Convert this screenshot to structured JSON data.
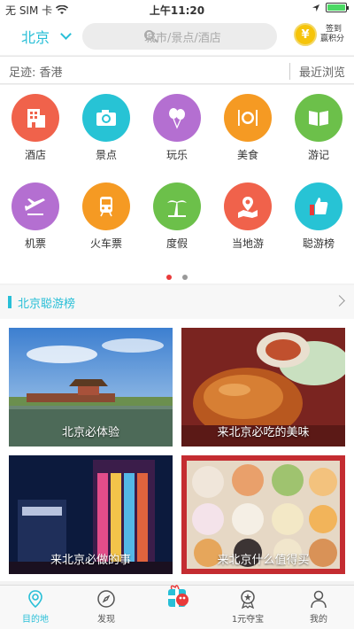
{
  "status": {
    "carrier": "无 SIM 卡",
    "time": "上午11:20"
  },
  "header": {
    "city": "北京",
    "search_placeholder": "城市/景点/酒店",
    "signin_line1": "签到",
    "signin_line2": "赢积分",
    "coin_symbol": "¥"
  },
  "history": {
    "footprint": "足迹: 香港",
    "recent": "最近浏览"
  },
  "categories": [
    {
      "label": "酒店",
      "icon": "hotel-icon",
      "color": "#f0624b"
    },
    {
      "label": "景点",
      "icon": "camera-icon",
      "color": "#27c3d5"
    },
    {
      "label": "玩乐",
      "icon": "balloons-icon",
      "color": "#b46fd1"
    },
    {
      "label": "美食",
      "icon": "dining-icon",
      "color": "#f59a23"
    },
    {
      "label": "游记",
      "icon": "book-icon",
      "color": "#6cc04a"
    },
    {
      "label": "机票",
      "icon": "airplane-icon",
      "color": "#b46fd1"
    },
    {
      "label": "火车票",
      "icon": "train-icon",
      "color": "#f59a23"
    },
    {
      "label": "度假",
      "icon": "palm-tree-icon",
      "color": "#6cc04a"
    },
    {
      "label": "当地游",
      "icon": "map-pin-icon",
      "color": "#f0624b"
    },
    {
      "label": "聪游榜",
      "icon": "thumbs-up-icon",
      "color": "#27c3d5"
    }
  ],
  "pager": {
    "pages": 2,
    "active": 0
  },
  "section": {
    "title": "北京聪游榜"
  },
  "cards": [
    {
      "caption": "北京必体验"
    },
    {
      "caption": "来北京必吃的美味"
    },
    {
      "caption": "来北京必做的事"
    },
    {
      "caption": "来北京什么值得买"
    }
  ],
  "tabs": [
    {
      "label": "目的地",
      "icon": "location-pin-icon"
    },
    {
      "label": "发现",
      "icon": "compass-icon"
    },
    {
      "label": "",
      "icon": "gift-mascot-icon"
    },
    {
      "label": "1元夺宝",
      "icon": "medal-icon"
    },
    {
      "label": "我的",
      "icon": "user-icon"
    }
  ],
  "colors": {
    "accent": "#28bfd7",
    "pager_active": "#e93a3a"
  }
}
